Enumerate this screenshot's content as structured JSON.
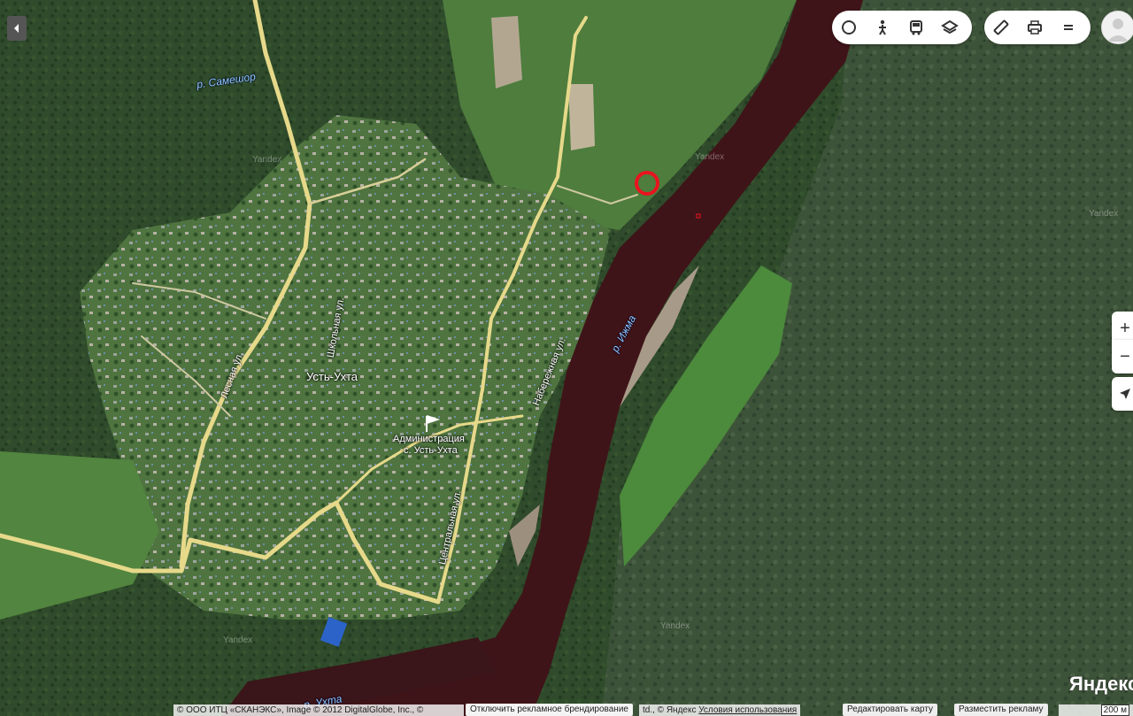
{
  "map": {
    "watermark": "Yandex",
    "labels": {
      "river_sameshor": "р. Самешор",
      "river_izhma": "р. Ижма",
      "river_ukhta": "р. Ухта",
      "village": "Усть-Ухта",
      "admin_line1": "Администрация",
      "admin_line2": "с. Усть-Ухта",
      "street_lesnaya": "Лесная ул.",
      "street_shkolnaya": "Школьная ул.",
      "street_naberezhnaya": "Набережная ул.",
      "street_tsentralnaya": "Центральная ул."
    },
    "colors": {
      "forest": "#2c4a27",
      "river": "#3e1418",
      "road": "#e8dc8c",
      "marker": "#e8141e"
    }
  },
  "toolbar": {
    "layers_tools": [
      "circle-tool-icon",
      "pedestrian-icon",
      "bus-icon",
      "layers-icon"
    ],
    "right_tools": [
      "ruler-icon",
      "print-icon",
      "menu-icon"
    ]
  },
  "zoom": {
    "in": "+",
    "out": "−"
  },
  "footer": {
    "copyright": "© ООО ИТЦ «СКАНЭКС», Image © 2012 DigitalGlobe, Inc., ©",
    "disable_branding": "Отключить рекламное брендирование",
    "yandex_copy": "td., © Яндекс",
    "terms": "Условия использования",
    "edit_map": "Редактировать карту",
    "place_ad": "Разместить рекламу",
    "scale": "200 м"
  },
  "logo": "Яндекс"
}
